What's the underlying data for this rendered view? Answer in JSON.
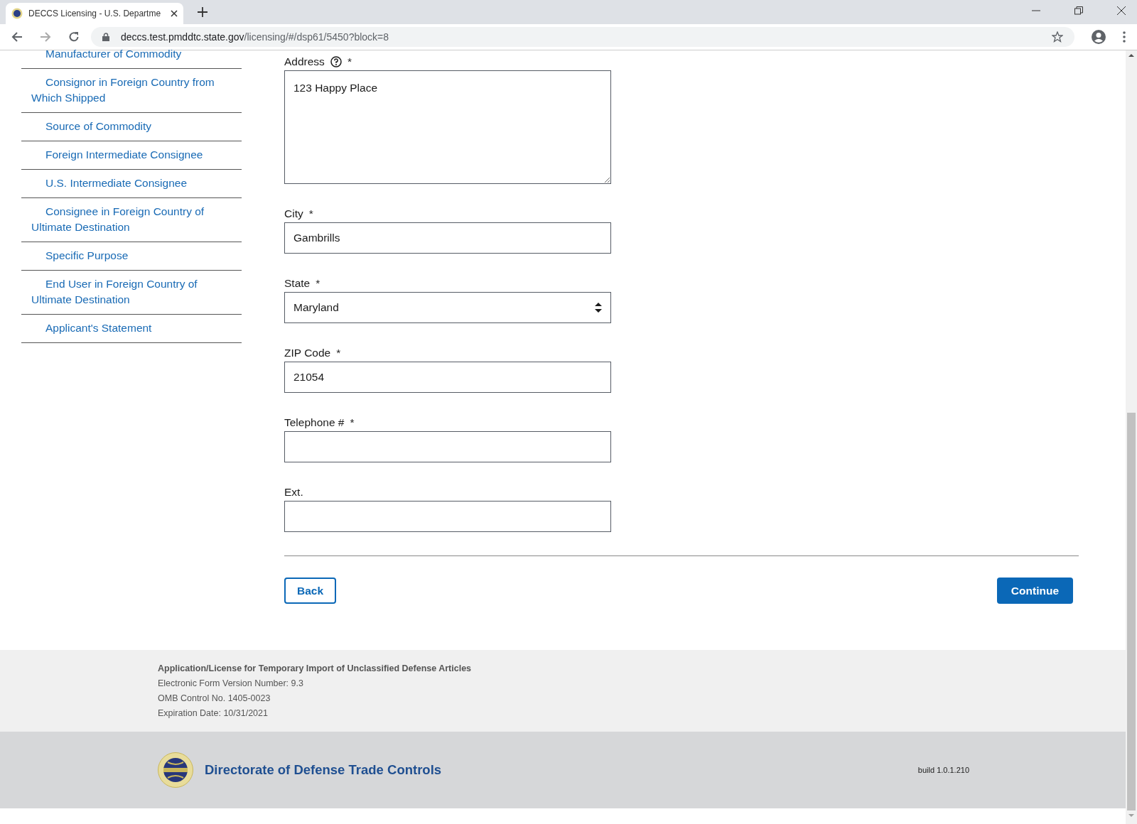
{
  "browser": {
    "tab_title": "DECCS Licensing - U.S. Departme",
    "url_host": "deccs.test.pmddtc.state.gov",
    "url_path": "/licensing/#/dsp61/5450?block=8"
  },
  "sidebar": {
    "items": [
      {
        "label": "Manufacturer of Commodity"
      },
      {
        "label": "Consignor in Foreign Country from Which Shipped"
      },
      {
        "label": "Source of Commodity"
      },
      {
        "label": "Foreign Intermediate Consignee"
      },
      {
        "label": "U.S. Intermediate Consignee"
      },
      {
        "label": "Consignee in Foreign Country of Ultimate Destination"
      },
      {
        "label": "Specific Purpose"
      },
      {
        "label": "End User in Foreign Country of Ultimate Destination"
      },
      {
        "label": "Applicant's Statement"
      }
    ]
  },
  "form": {
    "fields": [
      {
        "kind": "textarea",
        "label": "Address",
        "help": true,
        "required_mark": "*",
        "value": "123 Happy Place"
      },
      {
        "kind": "text",
        "label": "City",
        "help": false,
        "required_mark": "*",
        "value": "Gambrills"
      },
      {
        "kind": "select",
        "label": "State",
        "help": false,
        "required_mark": "*",
        "value": "Maryland"
      },
      {
        "kind": "text",
        "label": "ZIP Code",
        "help": false,
        "required_mark": "*",
        "value": "21054"
      },
      {
        "kind": "text",
        "label": "Telephone #",
        "help": false,
        "required_mark": "*"
      },
      {
        "kind": "text",
        "label": "Ext.",
        "help": false
      }
    ],
    "back": "Back",
    "continue": "Continue"
  },
  "footer": {
    "title": "Application/License for Temporary Import of Unclassified Defense Articles",
    "lines": [
      "Electronic Form Version Number: 9.3",
      "OMB Control No. 1405-0023",
      "Expiration Date: 10/31/2021"
    ]
  },
  "brand": {
    "name": "Directorate of Defense Trade Controls",
    "build": "build 1.0.1.210"
  }
}
